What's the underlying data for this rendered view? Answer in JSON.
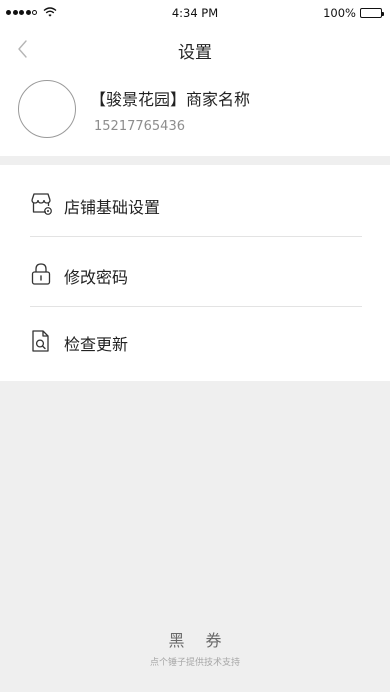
{
  "status_bar": {
    "time": "4:34 PM",
    "battery": "100%"
  },
  "nav": {
    "title": "设置",
    "back_icon": "chevron-left-icon"
  },
  "profile": {
    "shop_name": "【骏景花园】商家名称",
    "phone": "15217765436"
  },
  "menu": {
    "items": [
      {
        "label": "店铺基础设置",
        "icon": "shop-icon"
      },
      {
        "label": "修改密码",
        "icon": "lock-icon"
      },
      {
        "label": "检查更新",
        "icon": "document-search-icon"
      }
    ]
  },
  "footer": {
    "brand": "黑 券",
    "note": "点个锤子提供技术支持"
  },
  "colors": {
    "page_background": "#efefef",
    "card_background": "#ffffff",
    "text_primary": "#222222",
    "text_secondary": "#8d8d8d"
  }
}
